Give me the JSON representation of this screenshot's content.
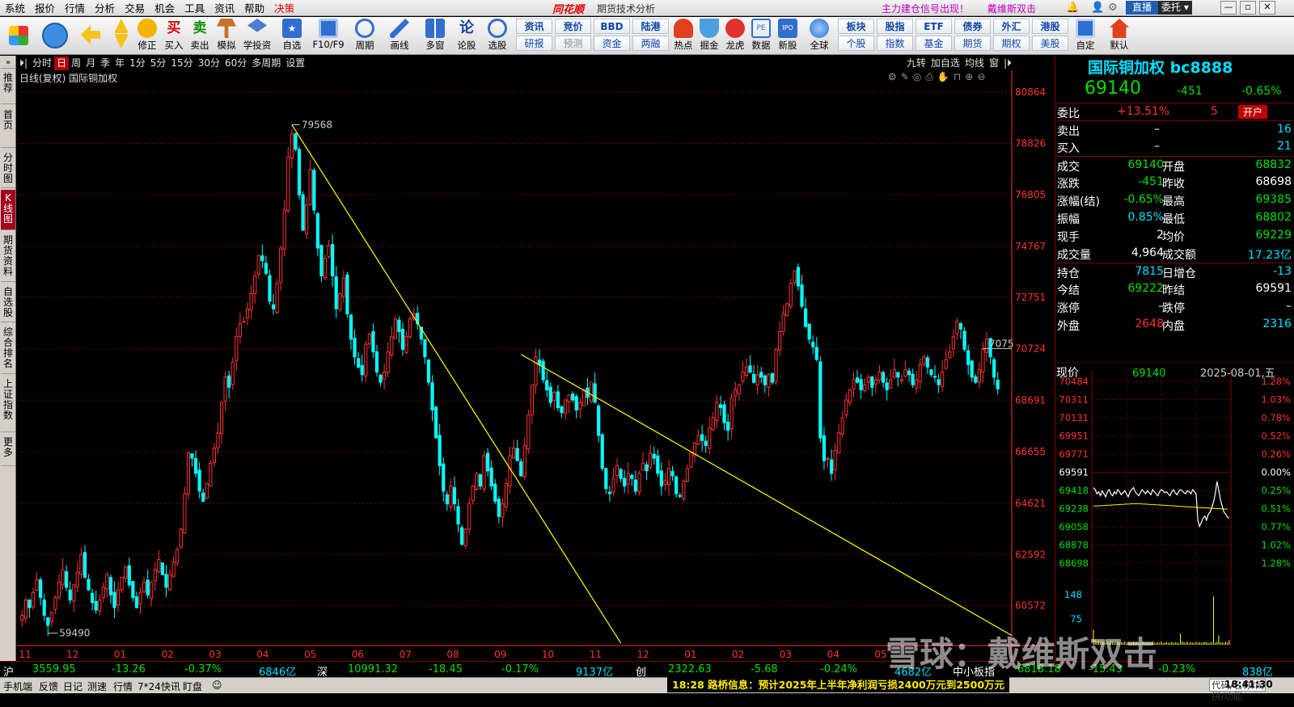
{
  "menu": {
    "items": [
      "系统",
      "报价",
      "行情",
      "分析",
      "交易",
      "机会",
      "工具",
      "资讯",
      "帮助",
      "决策"
    ],
    "brand": "同花顺",
    "subtitle": "期货技术分析",
    "promo1": "主力建仓信号出现！",
    "promo2": "戴维斯双击",
    "live": "直播",
    "user": "委托",
    "win_min": "—",
    "win_max": "▫",
    "win_close": "✕"
  },
  "toolbar": {
    "icon_buttons": [
      "修正",
      "买入",
      "卖出",
      "模拟",
      "学投资",
      "自选",
      "F10/F9",
      "周期",
      "画线",
      "多窗",
      "论股",
      "选股",
      "热点",
      "掘金",
      "龙虎",
      "数据",
      "新股",
      "全球",
      "自定",
      "默认"
    ],
    "text_buttons_top": [
      "资讯",
      "竞价",
      "BBD",
      "陆港",
      "板块",
      "股指",
      "ETF",
      "债券",
      "外汇",
      "港股"
    ],
    "text_buttons_bottom": [
      "研报",
      "预测",
      "资金",
      "两融",
      "个股",
      "指数",
      "基金",
      "期货",
      "期权",
      "美股"
    ]
  },
  "leftnav": {
    "items": [
      "推荐",
      "首页",
      "分时图",
      "K线图",
      "期货资料",
      "自选股",
      "综合排名",
      "上证指数",
      "更多"
    ],
    "active": "K线图"
  },
  "periods": {
    "items": [
      "分时",
      "日",
      "周",
      "月",
      "季",
      "年",
      "1分",
      "5分",
      "15分",
      "30分",
      "60分",
      "多周期",
      "设置"
    ],
    "selected": "日",
    "right_items": [
      "九转",
      "加自选",
      "均线",
      "窗"
    ]
  },
  "chart_title": "日线(复权) 国际铜加权",
  "chart_data": {
    "type": "candlestick",
    "title": "日线(复权) 国际铜加权",
    "y_ticks": [
      80864,
      78826,
      76805,
      74767,
      72751,
      70724,
      68691,
      66655,
      64621,
      62592,
      60572
    ],
    "ylim": [
      59000,
      81400
    ],
    "x_ticks": [
      "11",
      "12",
      "01",
      "02",
      "03",
      "04",
      "05",
      "06",
      "07",
      "08",
      "09",
      "10",
      "11",
      "12",
      "01",
      "02",
      "03",
      "04",
      "05"
    ],
    "annotations": {
      "high_label": "79568",
      "low_label": "59490",
      "last_label": "7075"
    },
    "closes": [
      60200,
      60800,
      60500,
      61100,
      61600,
      60900,
      60200,
      59800,
      60300,
      60900,
      61500,
      62000,
      61300,
      60800,
      61400,
      61900,
      62600,
      61700,
      61200,
      60700,
      60400,
      60800,
      61300,
      61800,
      61000,
      60500,
      61200,
      61700,
      62100,
      61400,
      60900,
      60500,
      61100,
      61500,
      61000,
      61500,
      62000,
      62400,
      61800,
      61300,
      61800,
      62300,
      62800,
      63600,
      65000,
      66600,
      66400,
      65800,
      65100,
      64700,
      65400,
      66200,
      66800,
      67400,
      68600,
      69600,
      69200,
      70200,
      71200,
      71700,
      71800,
      72300,
      72900,
      73600,
      74400,
      74200,
      73700,
      72600,
      72300,
      73300,
      74700,
      76200,
      78300,
      79200,
      78600,
      76800,
      75400,
      76400,
      77800,
      76200,
      74700,
      73600,
      74300,
      74800,
      73600,
      72300,
      72900,
      73500,
      72100,
      71100,
      70400,
      70000,
      69700,
      70900,
      71300,
      70600,
      69800,
      69400,
      69800,
      70600,
      71200,
      71900,
      71400,
      70700,
      71200,
      71900,
      72100,
      71700,
      71100,
      70400,
      69400,
      68300,
      67200,
      66100,
      65100,
      64600,
      65300,
      64600,
      63800,
      63000,
      63600,
      64600,
      65300,
      65800,
      65300,
      66500,
      65900,
      65300,
      64700,
      64100,
      64600,
      65400,
      66500,
      66800,
      66300,
      65700,
      66900,
      68100,
      69300,
      70400,
      70100,
      69500,
      69100,
      68600,
      69000,
      68400,
      68200,
      68700,
      68900,
      68700,
      68300,
      68600,
      69100,
      68800,
      69400,
      68600,
      67300,
      66000,
      65200,
      65000,
      65600,
      66100,
      65600,
      65300,
      65800,
      65600,
      65100,
      65800,
      66200,
      65900,
      66600,
      66400,
      65800,
      65300,
      65500,
      66000,
      65700,
      65000,
      64900,
      65500,
      66000,
      66600,
      67000,
      67300,
      67100,
      66900,
      67600,
      68000,
      68600,
      68400,
      67800,
      67500,
      68800,
      69100,
      69300,
      69800,
      70000,
      69800,
      69400,
      69700,
      69600,
      69300,
      69700,
      69400,
      70700,
      71400,
      72100,
      72500,
      73300,
      73800,
      73200,
      72400,
      71600,
      71100,
      70800,
      70300,
      67200,
      66300,
      66400,
      65800,
      66700,
      67400,
      68000,
      68700,
      69100,
      69500,
      69400,
      69100,
      69300,
      69600,
      69200,
      69500,
      69800,
      69400,
      69100,
      69500,
      69900,
      69600,
      69500,
      69900,
      69700,
      69300,
      69500,
      70100,
      70400,
      70000,
      69700,
      69600,
      69300,
      69800,
      70300,
      70600,
      71200,
      71800,
      71500,
      70700,
      70100,
      69600,
      69400,
      69900,
      70700,
      71100,
      70400,
      69600,
      69140
    ]
  },
  "quote": {
    "title": "国际铜加权 bc8888",
    "price": "69140",
    "change": "-451",
    "pct": "-0.65%",
    "wb_label": "委比",
    "wb_val": "+13.51%",
    "wb_num": "5",
    "open_btn": "开户",
    "sell_label": "卖出",
    "sell_price": "–",
    "sell_qty": "16",
    "buy_label": "买入",
    "buy_price": "–",
    "buy_qty": "21",
    "rows": [
      {
        "l1": "成交",
        "v1": "69140",
        "c1": "green",
        "l2": "开盘",
        "v2": "68832",
        "c2": "green"
      },
      {
        "l1": "涨跌",
        "v1": "-451",
        "c1": "green",
        "l2": "昨收",
        "v2": "68698",
        "c2": "white"
      },
      {
        "l1": "涨幅(结)",
        "v1": "-0.65%",
        "c1": "green",
        "l2": "最高",
        "v2": "69385",
        "c2": "green"
      },
      {
        "l1": "振幅",
        "v1": "0.85%",
        "c1": "cyan",
        "l2": "最低",
        "v2": "68802",
        "c2": "green"
      },
      {
        "l1": "现手",
        "v1": "2",
        "c1": "white",
        "l2": "均价",
        "v2": "69229",
        "c2": "green"
      },
      {
        "l1": "成交量",
        "v1": "4,964",
        "c1": "white",
        "l2": "成交额",
        "v2": "17.23亿",
        "c2": "cyan"
      },
      {
        "l1": "持仓",
        "v1": "7815",
        "c1": "cyan",
        "l2": "日增仓",
        "v2": "-13",
        "c2": "cyan"
      },
      {
        "l1": "今结",
        "v1": "69222",
        "c1": "green",
        "l2": "昨结",
        "v2": "69591",
        "c2": "white"
      },
      {
        "l1": "涨停",
        "v1": "–",
        "c1": "white",
        "l2": "跌停",
        "v2": "–",
        "c2": "white"
      },
      {
        "l1": "外盘",
        "v1": "2648",
        "c1": "red",
        "l2": "内盘",
        "v2": "2316",
        "c2": "cyan"
      }
    ]
  },
  "mini": {
    "label": "现价",
    "price": "69140",
    "date": "2025-08-01,五",
    "prices": [
      "70484",
      "70311",
      "70131",
      "69951",
      "69771",
      "69591",
      "69418",
      "69238",
      "69058",
      "68878",
      "68698"
    ],
    "pcts": [
      "1.28%",
      "1.03%",
      "0.78%",
      "0.52%",
      "0.26%",
      "0.00%",
      "0.25%",
      "0.51%",
      "0.77%",
      "1.02%",
      "1.28%"
    ],
    "vol_labels": [
      "148",
      "75"
    ],
    "price_line": [
      69440,
      69420,
      69380,
      69400,
      69360,
      69410,
      69380,
      69350,
      69400,
      69420,
      69380,
      69360,
      69400,
      69380,
      69420,
      69400,
      69370,
      69390,
      69410,
      69380,
      69350,
      69400,
      69420,
      69440,
      69400,
      69380,
      69360,
      69390,
      69420,
      69400,
      69380,
      69410,
      69390,
      69370,
      69420,
      69400,
      69380,
      69360,
      69400,
      69420,
      69410,
      69390,
      69400,
      69380,
      69360,
      69400,
      69420,
      69390,
      69370,
      69400,
      69420,
      69410,
      69390,
      69380,
      69410,
      69400,
      69380,
      69420,
      69400,
      69380,
      69120,
      69060,
      69100,
      69140,
      69160,
      69120,
      69180,
      69200,
      69240,
      69300,
      69380,
      69500,
      69420,
      69320,
      69260,
      69200,
      69180,
      69150,
      69140
    ],
    "avg_line": [
      69260,
      69260,
      69262,
      69264,
      69266,
      69268,
      69270,
      69272,
      69274,
      69276,
      69278,
      69280,
      69282,
      69282,
      69282,
      69280,
      69278,
      69276,
      69274,
      69272,
      69270,
      69268,
      69266,
      69264,
      69262,
      69260,
      69258,
      69256,
      69254,
      69252,
      69250,
      69248,
      69246,
      69244,
      69242,
      69240,
      69238,
      69236,
      69234,
      69232,
      69230,
      69229
    ],
    "volumes": [
      40,
      12,
      8,
      10,
      6,
      9,
      7,
      5,
      8,
      6,
      10,
      7,
      5,
      6,
      8,
      5,
      7,
      6,
      9,
      5,
      7,
      6,
      5,
      8,
      6,
      7,
      5,
      6,
      8,
      7,
      5,
      6,
      7,
      5,
      8,
      6,
      5,
      7,
      6,
      9,
      5,
      6,
      7,
      5,
      6,
      8,
      5,
      7,
      6,
      5,
      30,
      9,
      7,
      6,
      8,
      5,
      7,
      6,
      5,
      8,
      6,
      7,
      5,
      6,
      8,
      7,
      5,
      6,
      7,
      128,
      6,
      8,
      25,
      7,
      6,
      5,
      8,
      6,
      12
    ]
  },
  "statusbar": {
    "sh_label": "沪",
    "sh_val": "3559.95",
    "sh_chg": "-13.26",
    "sh_pct": "-0.37%",
    "sh_amt": "6846亿",
    "sz_label": "深",
    "sz_val": "10991.32",
    "sz_chg": "-18.45",
    "sz_pct": "-0.17%",
    "sz_amt": "9137亿",
    "cy_label": "创",
    "cy_val": "2322.63",
    "cy_chg": "-5.68",
    "cy_pct": "-0.24%",
    "cy_amt": "4682亿",
    "zx_label": "中小板指",
    "zx_val": "6818.18",
    "zx_chg": "-15.43",
    "zx_pct": "-0.23%",
    "zx_amt": "838亿"
  },
  "bottombar": {
    "items": [
      "手机端",
      "反馈",
      "日记",
      "测速",
      "行情",
      "7*24快讯",
      "盯盘"
    ],
    "news": "18:28 路桥信息：预计2025年上半年净利润亏损2400万元到2500万元",
    "search_placeholder": "代码/名称/简拼/功能",
    "time": "18:41:30"
  },
  "watermark": "雪球：戴维斯双击",
  "colors": {
    "up": "#ff3030",
    "down": "#00ffff",
    "line": "#ffff00",
    "grid": "#7a0000",
    "axis": "#ff3030"
  }
}
